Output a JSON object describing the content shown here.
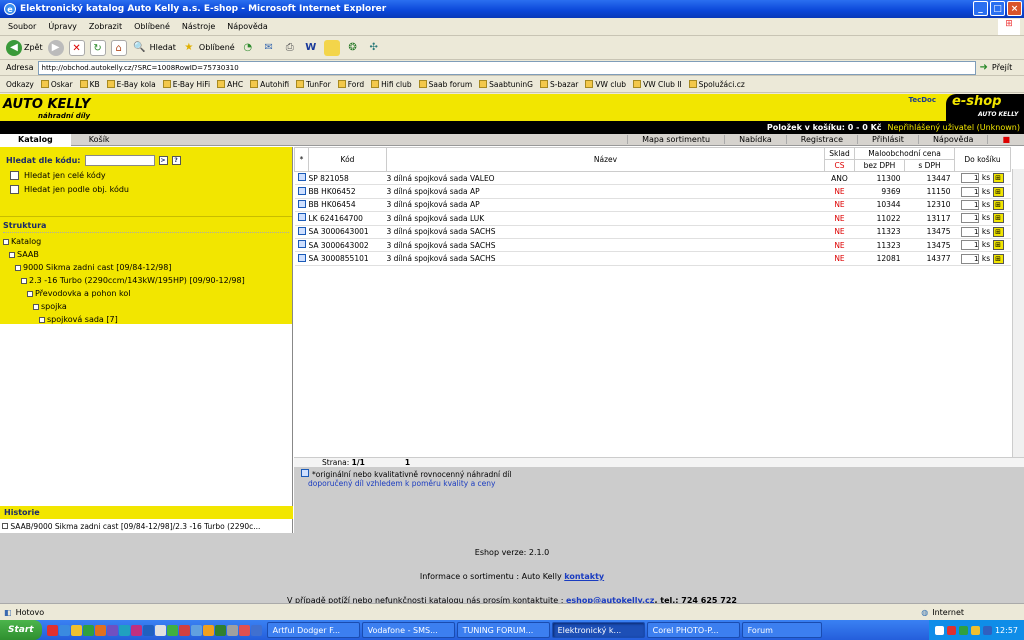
{
  "window": {
    "title": "Elektronický katalog Auto Kelly a.s. E-shop - Microsoft Internet Explorer"
  },
  "menu": [
    "Soubor",
    "Úpravy",
    "Zobrazit",
    "Oblíbené",
    "Nástroje",
    "Nápověda"
  ],
  "toolbar": {
    "back": "Zpět",
    "search": "Hledat",
    "favorites": "Oblíbené"
  },
  "address": {
    "label": "Adresa",
    "url": "http://obchod.autokelly.cz/?SRC=1008RowID=75730310",
    "go": "Přejít"
  },
  "links": {
    "label": "Odkazy",
    "items": [
      "Oskar",
      "KB",
      "E-Bay kola",
      "E-Bay HiFi",
      "AHC",
      "Autohifi",
      "TunFor",
      "Ford",
      "Hifi club",
      "Saab forum",
      "SaabtuninG",
      "S-bazar",
      "VW club",
      "VW Club II",
      "Spolužáci.cz"
    ]
  },
  "brand": {
    "logo": "AUTO KELLY",
    "sub": "náhradní díly",
    "tecdoc": "TecDoc",
    "eshop": "e-shop",
    "eshop_sub": "AUTO KELLY"
  },
  "info": {
    "cart": "Položek v košíku: 0 - 0 Kč",
    "user": "Nepřihlášený uživatel (Unknown)"
  },
  "nav": {
    "katalog": "Katalog",
    "kosik": "Košík",
    "right": [
      "Mapa sortimentu",
      "Nabídka",
      "Registrace",
      "Přihlásit",
      "Nápověda"
    ]
  },
  "search": {
    "label": "Hledat dle kódu:",
    "btn1": "&gt;",
    "btn2": "?",
    "opt1": "Hledat jen celé kódy",
    "opt2": "Hledat jen podle obj. kódu"
  },
  "tree": {
    "title": "Struktura",
    "nodes": [
      "Katalog",
      "SAAB",
      "9000 Sikma zadni cast [09/84-12/98]",
      "2.3 -16 Turbo (2290ccm/143kW/195HP) [09/90-12/98]",
      "Převodovka a pohon kol",
      "spojka",
      "spojková sada [7]"
    ]
  },
  "history": {
    "title": "Historie",
    "item": "SAAB/9000 Sikma zadni cast [09/84-12/98]/2.3 -16 Turbo (2290c..."
  },
  "table": {
    "headers": {
      "star": "*",
      "code": "Kód",
      "name": "Název",
      "stock": "Sklad",
      "stock_sub": "CS",
      "price": "Maloobchodní cena",
      "price_ex": "bez DPH",
      "price_inc": "s DPH",
      "cart": "Do košíku"
    },
    "unit": "ks",
    "rows": [
      {
        "code": "SP 821058",
        "name": "3 dílná spojková sada VALEO",
        "stock": "ANO",
        "ex": "11300",
        "inc": "13447",
        "qty": "1"
      },
      {
        "code": "BB HK06452",
        "name": "3 dílná spojková sada AP",
        "stock": "NE",
        "ex": "9369",
        "inc": "11150",
        "qty": "1"
      },
      {
        "code": "BB HK06454",
        "name": "3 dílná spojková sada AP",
        "stock": "NE",
        "ex": "10344",
        "inc": "12310",
        "qty": "1"
      },
      {
        "code": "LK 624164700",
        "name": "3 dílná spojková sada LUK",
        "stock": "NE",
        "ex": "11022",
        "inc": "13117",
        "qty": "1"
      },
      {
        "code": "SA 3000643001",
        "name": "3 dílná spojková sada SACHS",
        "stock": "NE",
        "ex": "11323",
        "inc": "13475",
        "qty": "1"
      },
      {
        "code": "SA 3000643002",
        "name": "3 dílná spojková sada SACHS",
        "stock": "NE",
        "ex": "11323",
        "inc": "13475",
        "qty": "1"
      },
      {
        "code": "SA 3000855101",
        "name": "3 dílná spojková sada SACHS",
        "stock": "NE",
        "ex": "12081",
        "inc": "14377",
        "qty": "1"
      }
    ]
  },
  "pager": {
    "label": "Strana:",
    "value": "1/1",
    "page": "1"
  },
  "note": {
    "line1": "*originální nebo kvalitativně rovnocenný náhradní díl",
    "line2": "doporučený díl vzhledem k poměru kvality a ceny"
  },
  "footer": {
    "version": "Eshop verze: 2.1.0",
    "info": "Informace o sortimentu : Auto Kelly",
    "info_link": "kontakty",
    "contact": "V případě potíží nebo nefunkčnosti katalogu nás prosím kontaktujte :",
    "email": "eshop@autokelly.cz",
    "tel": ", tel.: 724 625 722"
  },
  "status": {
    "text": "Hotovo",
    "zone": "Internet"
  },
  "taskbar": {
    "start": "Start",
    "tasks": [
      "Artful Dodger F...",
      "Vodafone - SMS...",
      "TUNING FORUM...",
      "Elektronický k...",
      "Corel PHOTO-P...",
      "Forum"
    ],
    "active": 3,
    "clock": "12:57"
  }
}
